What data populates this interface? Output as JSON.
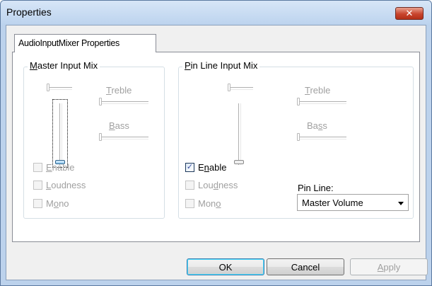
{
  "window": {
    "title": "Properties"
  },
  "tab": {
    "label": "AudioInputMixer Properties"
  },
  "master": {
    "title": "Master Input Mix",
    "treble_label": "Treble",
    "bass_label": "Bass",
    "enable_label": "Enable",
    "loudness_label": "Loudness",
    "mono_label": "Mono",
    "enable_checked": false,
    "enabled": false
  },
  "pin": {
    "title": "Pin Line Input Mix",
    "treble_label": "Treble",
    "bass_label": "Bass",
    "enable_label": "Enable",
    "loudness_label": "Loudness",
    "mono_label": "Mono",
    "enable_checked": true,
    "pin_line_label": "Pin Line:",
    "pin_line_value": "Master Volume"
  },
  "buttons": {
    "ok": "OK",
    "cancel": "Cancel",
    "apply": "Apply"
  },
  "icons": {
    "close": "close-icon",
    "check": "checkmark-icon",
    "dropdown": "chevron-down-icon"
  }
}
